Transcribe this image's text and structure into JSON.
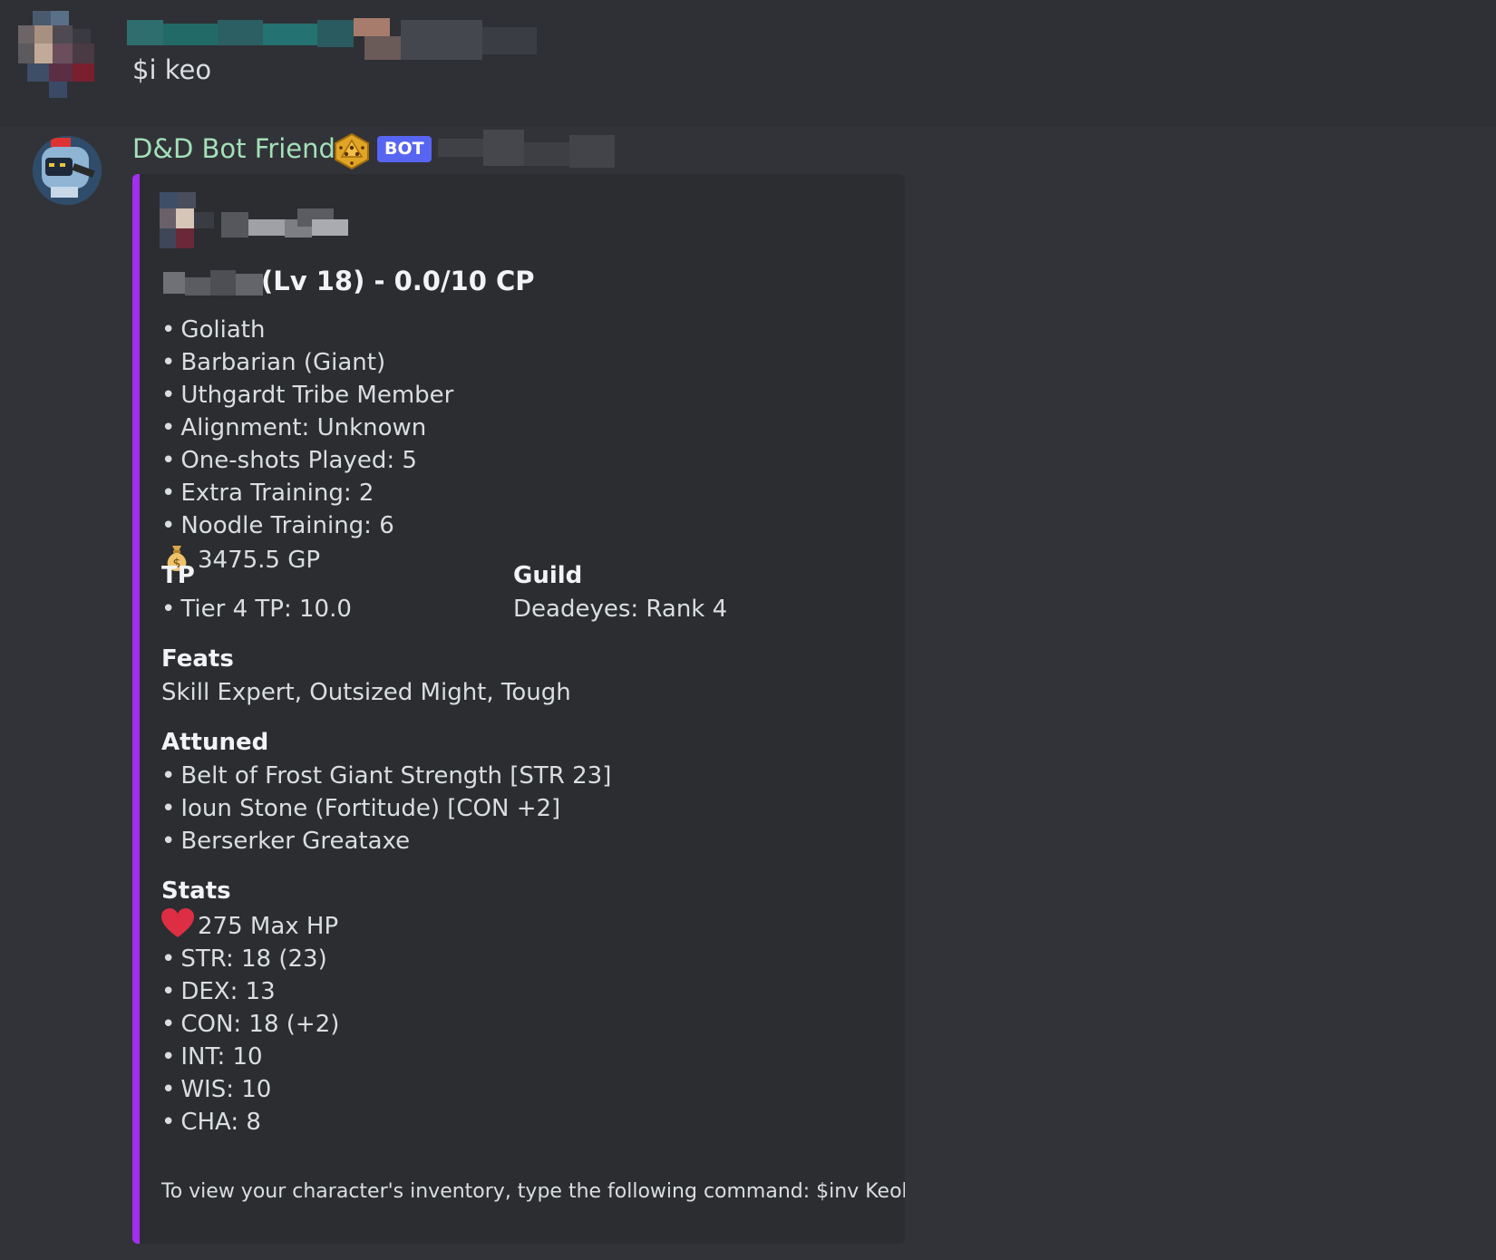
{
  "user_message": {
    "text": "$i keo"
  },
  "bot_message": {
    "author": "D&D Bot Friend",
    "author_icon": "dice-icon",
    "tag": "BOT",
    "embed": {
      "accent_color": "#a42ef0",
      "title": "(Lv 18) - 0.0/10 CP",
      "details": [
        "Goliath",
        "Barbarian (Giant)",
        "Uthgardt Tribe Member",
        "Alignment: Unknown",
        "One-shots Played: 5",
        "Extra Training: 2",
        "Noodle Training: 6"
      ],
      "gold": "3475.5 GP",
      "fields": {
        "tp": {
          "name": "TP",
          "value": "Tier 4 TP: 10.0"
        },
        "guild": {
          "name": "Guild",
          "value": "Deadeyes: Rank 4"
        },
        "feats": {
          "name": "Feats",
          "value": "Skill Expert, Outsized Might, Tough"
        },
        "attuned": {
          "name": "Attuned",
          "items": [
            "Belt of Frost Giant Strength [STR 23]",
            "Ioun Stone (Fortitude) [CON +2]",
            "Berserker Greataxe"
          ]
        },
        "stats": {
          "name": "Stats",
          "hp": "275 Max HP",
          "items": [
            "STR: 18 (23)",
            "DEX: 13",
            "CON: 18 (+2)",
            "INT: 10",
            "WIS: 10",
            "CHA: 8"
          ]
        }
      },
      "footer": "To view your character's inventory, type the following command: $inv Keokan"
    }
  },
  "colors": {
    "background": "#313338",
    "embed_background": "#2b2d31",
    "bot_name": "#a4e0b9",
    "bot_tag": "#5865f2"
  }
}
